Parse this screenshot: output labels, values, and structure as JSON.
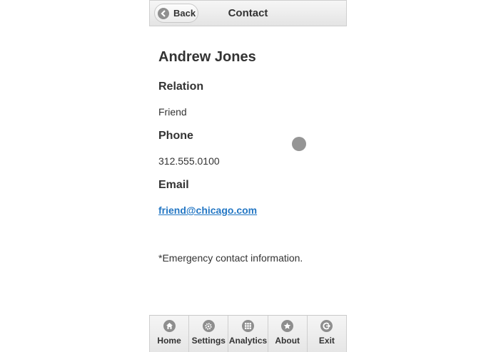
{
  "header": {
    "title": "Contact",
    "back_label": "Back"
  },
  "contact": {
    "name": "Andrew Jones",
    "relation_heading": "Relation",
    "relation_value": "Friend",
    "phone_heading": "Phone",
    "phone_value": "312.555.0100",
    "email_heading": "Email",
    "email_value": "friend@chicago.com",
    "note": "*Emergency contact information."
  },
  "navbar": {
    "items": [
      {
        "label": "Home",
        "icon": "home-icon"
      },
      {
        "label": "Settings",
        "icon": "gear-icon"
      },
      {
        "label": "Analytics",
        "icon": "grid-icon"
      },
      {
        "label": "About",
        "icon": "star-icon"
      },
      {
        "label": "Exit",
        "icon": "exit-icon"
      }
    ]
  },
  "colors": {
    "link": "#2477c4",
    "icon_gray": "#8e8e8e"
  }
}
